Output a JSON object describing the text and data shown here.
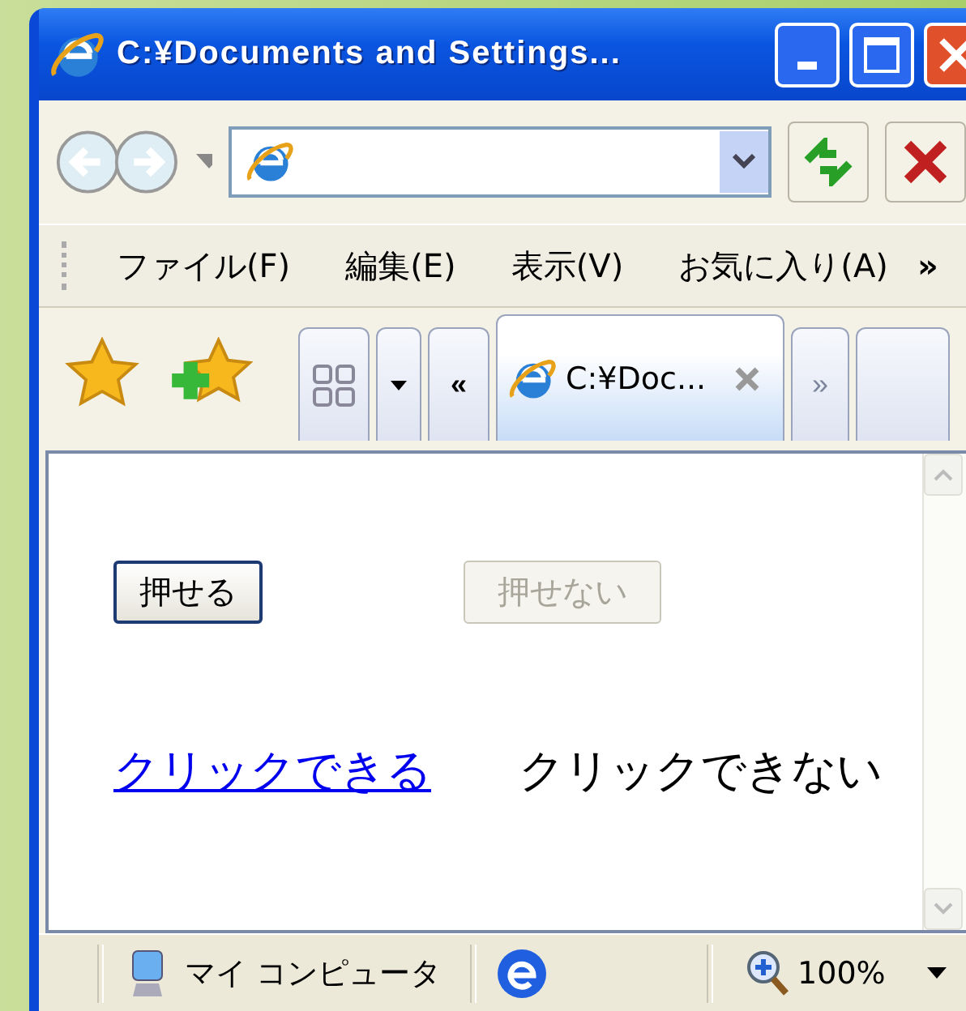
{
  "window": {
    "title": "C:¥Documents and Settings..."
  },
  "menu": [
    {
      "label": "ファイル(F)"
    },
    {
      "label": "編集(E)"
    },
    {
      "label": "表示(V)"
    },
    {
      "label": "お気に入り(A)"
    }
  ],
  "menu_more": "»",
  "tab_scroll_left": "«",
  "tab_scroll_right": "»",
  "tabs": [
    {
      "label": "C:¥Doc...",
      "selected": true
    }
  ],
  "buttons": [
    {
      "label": "押せる",
      "disabled": false
    },
    {
      "label": "押せない",
      "disabled": true
    }
  ],
  "links": [
    {
      "label": "クリックできる",
      "kind": "link"
    },
    {
      "label": "クリックできない",
      "kind": "text"
    }
  ],
  "status_bar": {
    "zone": "マイ コンピュータ",
    "zoom": "100%"
  }
}
